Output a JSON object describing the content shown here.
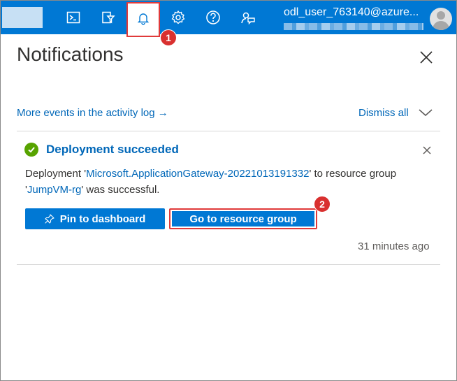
{
  "header": {
    "user_name": "odl_user_763140@azure...",
    "icons": [
      "terminal-icon",
      "directory-filter-icon",
      "bell-icon",
      "gear-icon",
      "help-icon",
      "feedback-icon"
    ]
  },
  "annotations": {
    "step1": "1",
    "step2": "2"
  },
  "panel": {
    "title": "Notifications",
    "activity_link": "More events in the activity log",
    "activity_arrow": "→",
    "dismiss_all": "Dismiss all"
  },
  "notification": {
    "title": "Deployment succeeded",
    "msg_prefix": "Deployment '",
    "deployment_name": "Microsoft.ApplicationGateway-20221013191332",
    "msg_middle": "' to resource group '",
    "resource_group": "JumpVM-rg",
    "msg_suffix": "' was successful.",
    "pin_button": "Pin to dashboard",
    "go_button": "Go to resource group",
    "time": "31 minutes ago"
  },
  "colors": {
    "topbar": "#0078d4",
    "link": "#0067b8",
    "success": "#57a300",
    "highlight": "#e03a3a"
  }
}
